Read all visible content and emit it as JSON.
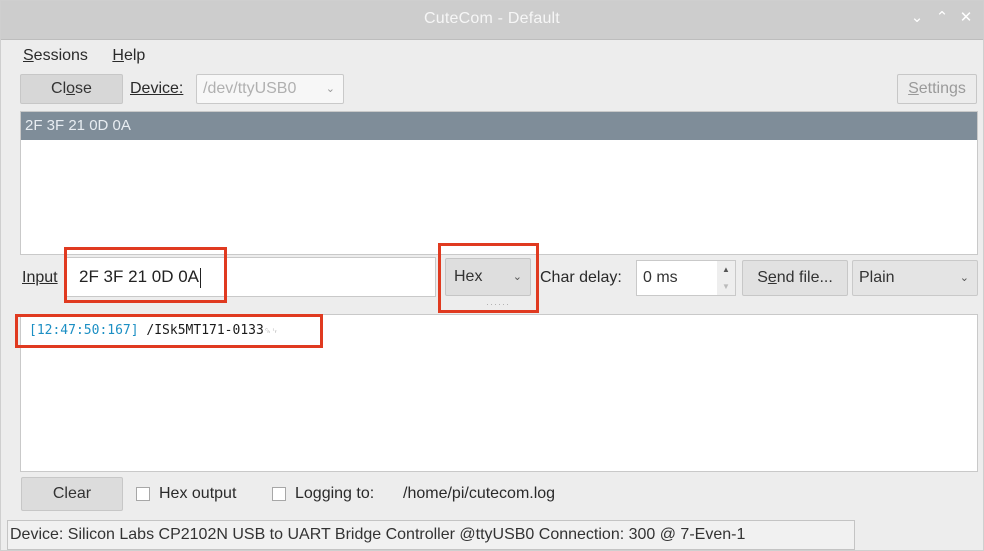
{
  "window": {
    "title": "CuteCom - Default",
    "controls": {
      "minimize": "⌄",
      "maximize": "⌃",
      "close": "✕"
    }
  },
  "menu": {
    "sessions": {
      "mnemonic": "S",
      "rest": "essions"
    },
    "help": {
      "mnemonic": "H",
      "rest": "elp"
    }
  },
  "toolbar": {
    "close_label_a": "Cl",
    "close_label_m": "o",
    "close_label_b": "se",
    "device_label": "Device:",
    "device_value": "/dev/ttyUSB0",
    "settings_label_m": "S",
    "settings_label_rest": "ettings"
  },
  "history": {
    "selected": "2F 3F 21 0D 0A"
  },
  "input_row": {
    "input_label": "Input",
    "input_value": "2F 3F 21 0D 0A",
    "mode_value": "Hex",
    "char_delay_label": "Char delay:",
    "char_delay_value": "0 ms",
    "send_file_a": "S",
    "send_file_m": "e",
    "send_file_b": "nd file...",
    "line_end_value": "Plain"
  },
  "output": {
    "timestamp": "[12:47:50:167]",
    "message": "/ISk5MT171-0133",
    "control_chars": "␍␊"
  },
  "bottom": {
    "clear_label": "Clear",
    "hex_output_label": "Hex output",
    "logging_label": "Logging to:",
    "log_path": "/home/pi/cutecom.log"
  },
  "status_bar": {
    "text": "Device: Silicon Labs CP2102N USB to UART Bridge Controller @ttyUSB0  Connection: 300 @ 7-Even-1"
  },
  "colors": {
    "highlight_box": "#e03a20",
    "timestamp": "#1c8fc4",
    "selection": "#7f8d99"
  }
}
